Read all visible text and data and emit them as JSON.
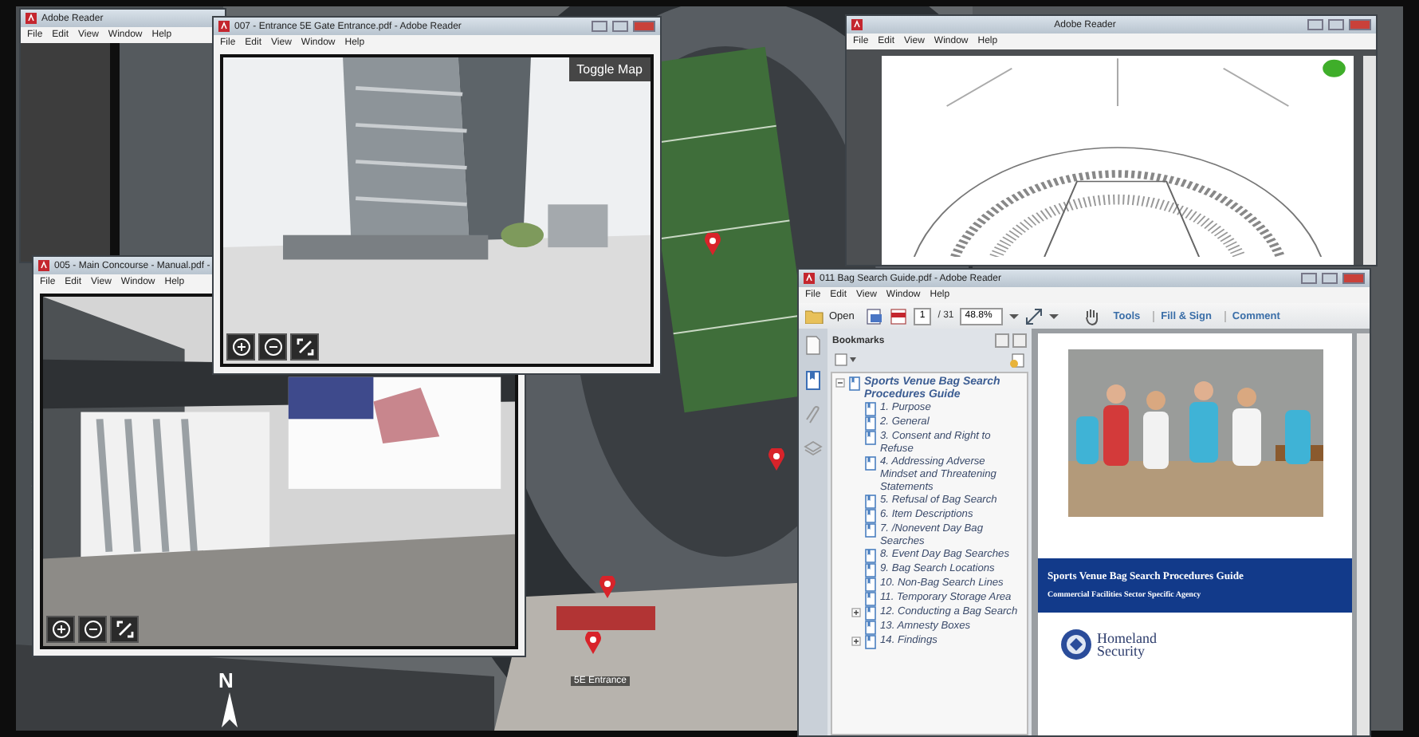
{
  "desktop": {
    "kind": "picture",
    "compass": "N",
    "place_label": "5E Entrance"
  },
  "windows": [
    {
      "kind": "reader",
      "title": "Adobe Reader",
      "menu": [
        "File",
        "Edit",
        "View",
        "Window",
        "Help"
      ]
    },
    {
      "kind": "plan",
      "title": "Adobe Reader",
      "menu": [
        "File",
        "Edit",
        "View",
        "Window",
        "Help"
      ]
    },
    {
      "kind": "viewer",
      "title": "005 - Main Concourse - Manual.pdf -",
      "menu": [
        "File",
        "Edit",
        "View",
        "Window",
        "Help"
      ]
    },
    {
      "kind": "viewer",
      "title": "007 - Entrance 5E Gate Entrance.pdf - Adobe Reader",
      "menu": [
        "File",
        "Edit",
        "View",
        "Window",
        "Help"
      ],
      "toggle": "Toggle Map"
    },
    {
      "kind": "guide",
      "title": "011 Bag Search Guide.pdf - Adobe Reader",
      "menu": [
        "File",
        "Edit",
        "View",
        "Window",
        "Help"
      ],
      "toolbar": {
        "open": "Open",
        "page": "1",
        "page_count": "/ 31",
        "zoom": "48.8%",
        "tools": "Tools",
        "fill_sign": "Fill & Sign",
        "comment": "Comment"
      },
      "bookmarks": {
        "title": "Bookmarks",
        "tree": [
          {
            "label": "Sports Venue Bag Search Procedures Guide",
            "expanded": true,
            "children": [
              {
                "label": "1. Purpose",
                "kind": "leaf"
              },
              {
                "label": "2. General",
                "kind": "leaf"
              },
              {
                "label": "3. Consent and Right to Refuse",
                "kind": "leaf"
              },
              {
                "label": "4. Addressing Adverse Mindset and Threatening Statements",
                "kind": "leaf"
              },
              {
                "label": "5. Refusal of Bag Search",
                "kind": "leaf"
              },
              {
                "label": "6. Item Descriptions",
                "kind": "leaf"
              },
              {
                "label": "7. /Nonevent Day Bag Searches",
                "kind": "leaf"
              },
              {
                "label": "8. Event Day Bag Searches",
                "kind": "leaf"
              },
              {
                "label": "9. Bag Search Locations",
                "kind": "leaf"
              },
              {
                "label": "10. Non-Bag Search Lines",
                "kind": "leaf"
              },
              {
                "label": "11. Temporary Storage Area",
                "kind": "leaf"
              },
              {
                "label": "12. Conducting a Bag Search",
                "kind": "collapsed"
              },
              {
                "label": "13. Amnesty Boxes",
                "kind": "leaf"
              },
              {
                "label": "14. Findings",
                "kind": "collapsed"
              }
            ]
          }
        ]
      },
      "document": {
        "heading": "Sports Venue Bag Search Procedures Guide",
        "subheading": "Commercial Facilities Sector Specific Agency",
        "logo_text": [
          "Homeland",
          "Security"
        ]
      }
    }
  ]
}
